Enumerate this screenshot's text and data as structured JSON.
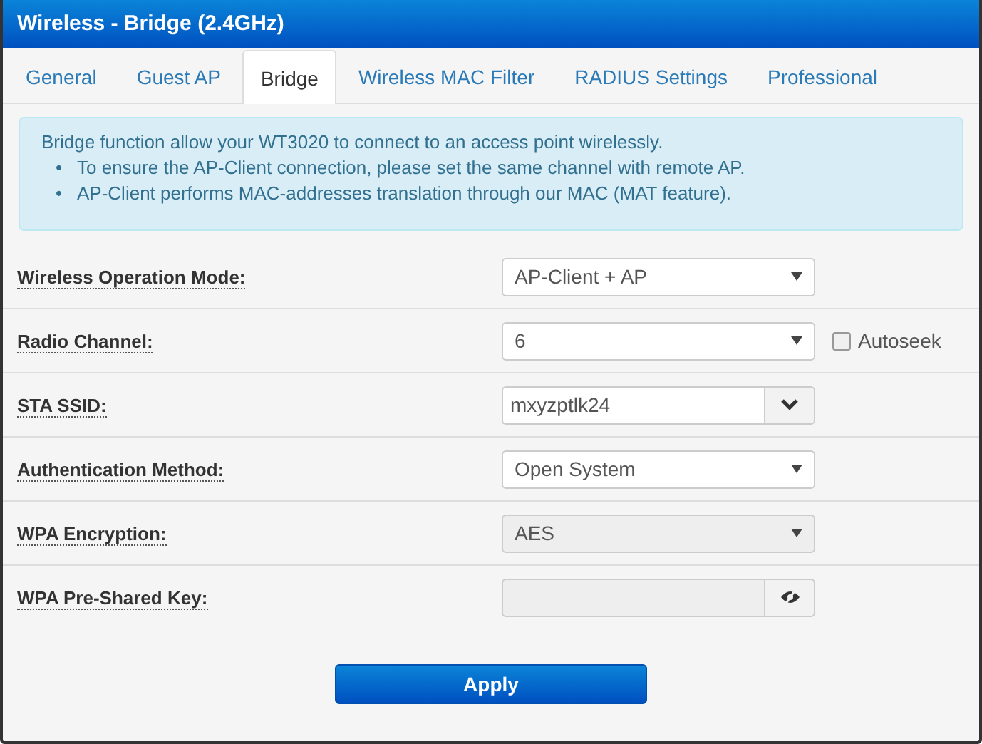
{
  "window": {
    "title": "Wireless - Bridge (2.4GHz)"
  },
  "tabs": [
    {
      "label": "General",
      "selected": false
    },
    {
      "label": "Guest AP",
      "selected": false
    },
    {
      "label": "Bridge",
      "selected": true
    },
    {
      "label": "Wireless MAC Filter",
      "selected": false
    },
    {
      "label": "RADIUS Settings",
      "selected": false
    },
    {
      "label": "Professional",
      "selected": false
    }
  ],
  "info": {
    "text": "Bridge function allow your WT3020 to connect to an access point wirelessly.",
    "bullets": [
      {
        "marker": "•",
        "text": "To ensure the AP-Client connection, please set the same channel with remote AP."
      },
      {
        "marker": "•",
        "text": "AP-Client performs MAC-addresses translation through our MAC (MAT feature)."
      }
    ]
  },
  "fields": [
    {
      "label": "Wireless Operation Mode:",
      "kind": "select",
      "value": "AP-Client + AP",
      "disabled": false
    },
    {
      "label": "Radio Channel:",
      "kind": "select",
      "value": "6",
      "disabled": false,
      "checkbox": {
        "label": "Autoseek",
        "checked": false
      }
    },
    {
      "label": "STA SSID:",
      "kind": "combo",
      "value": "mxyzptlk24",
      "disabled": false
    },
    {
      "label": "Authentication Method:",
      "kind": "select",
      "value": "Open System",
      "disabled": false
    },
    {
      "label": "WPA Encryption:",
      "kind": "select",
      "value": "AES",
      "disabled": true
    },
    {
      "label": "WPA Pre-Shared Key:",
      "kind": "password",
      "disabled": true
    }
  ],
  "buttons": [
    {
      "label": "Apply"
    }
  ]
}
